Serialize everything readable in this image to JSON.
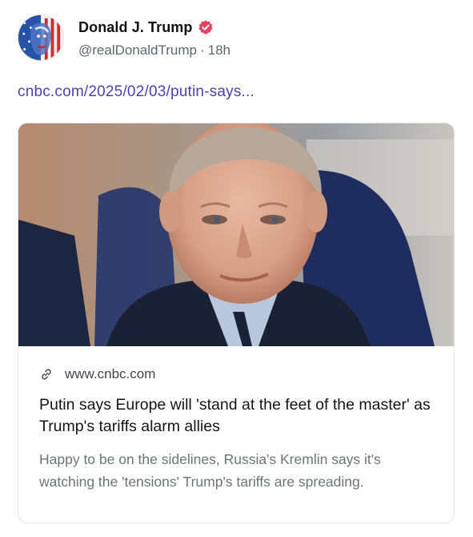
{
  "post": {
    "author": {
      "display_name": "Donald J. Trump",
      "handle": "@realDonaldTrump",
      "time_ago": "18h",
      "separator": "·",
      "avatar_icon": "avatar-portrait",
      "verified_icon": "verified-badge-icon",
      "verified_color": "#e8425e"
    },
    "link_text": "cnbc.com/2025/02/03/putin-says...",
    "link_color": "#4c3fb0",
    "link_card": {
      "image_icon": "article-photo",
      "link_icon": "link-icon",
      "domain": "www.cnbc.com",
      "title": "Putin says Europe will 'stand at the feet of the master' as Trump's tariffs alarm allies",
      "description": "Happy to be on the sidelines, Russia's Kremlin says it's watching the 'tensions' Trump's tariffs are spreading."
    }
  }
}
